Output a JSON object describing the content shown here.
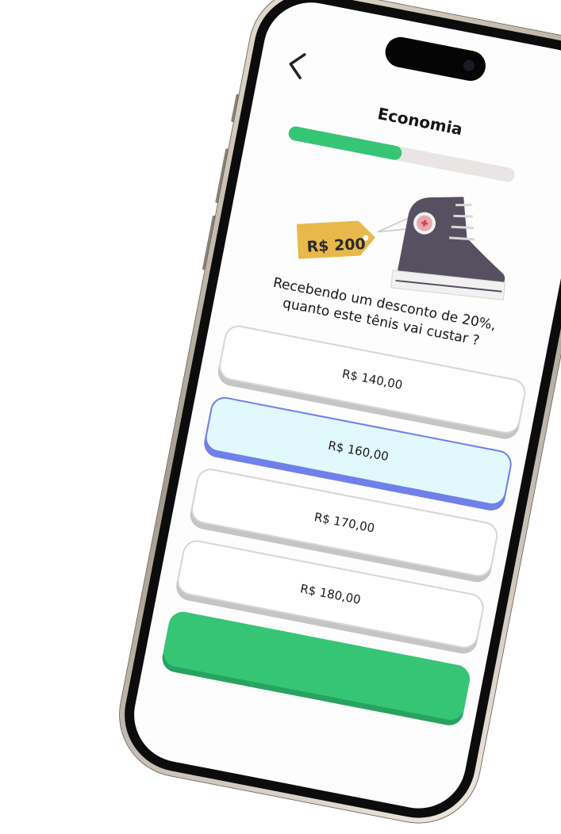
{
  "header": {
    "title": "Economia",
    "progress": 0.5
  },
  "hero": {
    "price_tag": "R$ 200"
  },
  "question": {
    "line1": "Recebendo um desconto de 20%,",
    "line2": "quanto este tênis vai custar ?"
  },
  "options": [
    {
      "label": "R$ 140,00"
    },
    {
      "label": "R$ 160,00"
    },
    {
      "label": "R$ 170,00"
    },
    {
      "label": "R$ 180,00"
    }
  ],
  "colors": {
    "progress": "#35c575",
    "selected_border": "#6f80ea",
    "selected_bg": "#e1f8fc",
    "tag": "#e8b84a"
  }
}
